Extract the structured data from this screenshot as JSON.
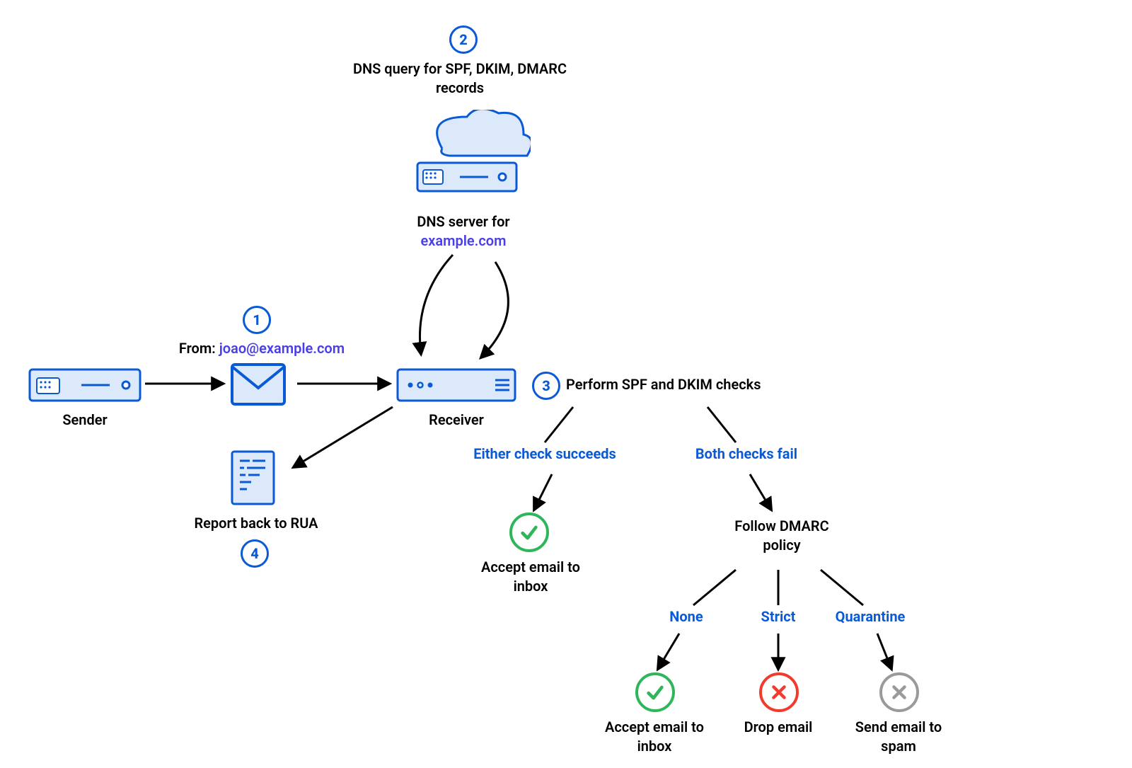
{
  "colors": {
    "accent_blue": "#0a5ad6",
    "accent_purple": "#4a3eeb",
    "green": "#2fb65a",
    "red": "#f23a2f",
    "gray": "#9a9a9a",
    "icon_fill": "#dbe9fb",
    "icon_stroke": "#0a5ad6"
  },
  "steps": {
    "1": {
      "number": "1",
      "from_label": "From:",
      "from_address": "joao@example.com"
    },
    "2": {
      "number": "2",
      "text": "DNS query for SPF, DKIM, DMARC records"
    },
    "3": {
      "number": "3",
      "text": "Perform SPF and DKIM checks"
    },
    "4": {
      "number": "4",
      "text": "Report back to RUA"
    }
  },
  "nodes": {
    "sender": "Sender",
    "receiver": "Receiver",
    "dns_label_1": "DNS server for",
    "dns_domain": "example.com"
  },
  "branches": {
    "either_succeeds": "Either check succeeds",
    "both_fail": "Both checks fail",
    "follow_policy": "Follow DMARC policy",
    "policies": {
      "none": "None",
      "strict": "Strict",
      "quarantine": "Quarantine"
    }
  },
  "outcomes": {
    "accept_inbox": "Accept email to inbox",
    "drop": "Drop email",
    "send_spam": "Send email to spam"
  }
}
